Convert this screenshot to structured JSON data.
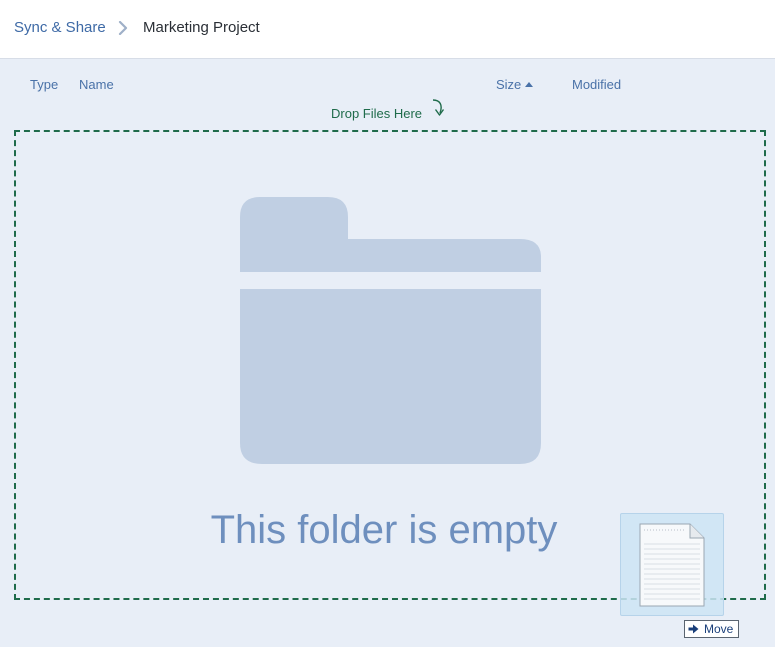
{
  "breadcrumb": {
    "root_label": "Sync & Share",
    "current_label": "Marketing Project"
  },
  "columns": {
    "type": "Type",
    "name": "Name",
    "size": "Size",
    "modified": "Modified",
    "sorted_by": "Size",
    "sort_direction": "ascending"
  },
  "drop_zone": {
    "hint": "Drop Files Here",
    "empty_message": "This folder is empty"
  },
  "drag": {
    "action_label": "Move"
  },
  "icons": {
    "breadcrumb_separator": "chevron-right-icon",
    "drop_arrow": "curved-arrow-down-icon",
    "folder": "folder-icon",
    "dragged_file": "document-icon",
    "move": "move-arrow-icon"
  },
  "colors": {
    "accent_blue": "#4a72a8",
    "drop_green": "#1f6b4b",
    "background": "#e8eef7",
    "folder_fill": "#c0cfe3",
    "empty_text": "#6e8fbe"
  }
}
